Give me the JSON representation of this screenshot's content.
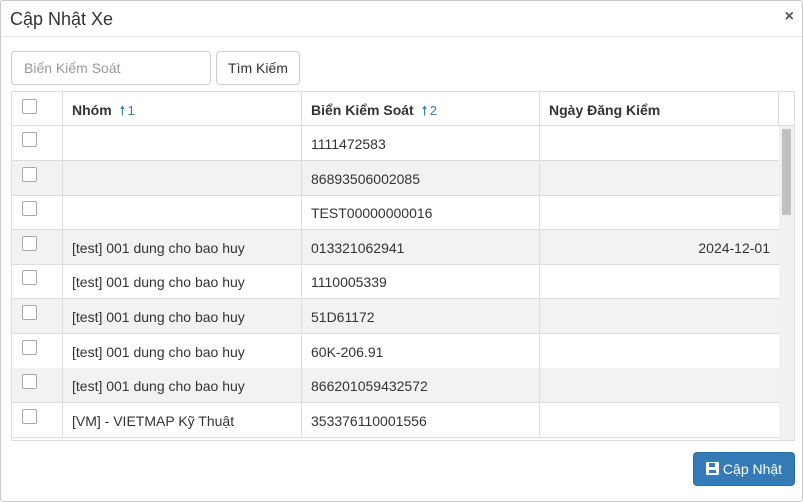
{
  "dialog": {
    "title": "Cập Nhật Xe",
    "close_label": "×"
  },
  "search": {
    "placeholder": "Biển Kiểm Soát",
    "value": "",
    "button_label": "Tìm Kiếm"
  },
  "table": {
    "headers": {
      "group": "Nhóm",
      "group_sort_order": "1",
      "plate": "Biển Kiểm Soát",
      "plate_sort_order": "2",
      "inspection_date": "Ngày Đăng Kiểm"
    },
    "sort_arrow": "🠕",
    "rows": [
      {
        "group": "",
        "plate": "1111472583",
        "date": ""
      },
      {
        "group": "",
        "plate": "86893506002085",
        "date": ""
      },
      {
        "group": "",
        "plate": "TEST00000000016",
        "date": ""
      },
      {
        "group": "[test] 001 dung cho bao huy",
        "plate": "013321062941",
        "date": "2024-12-01"
      },
      {
        "group": "[test] 001 dung cho bao huy",
        "plate": "1110005339",
        "date": ""
      },
      {
        "group": "[test] 001 dung cho bao huy",
        "plate": "51D61172",
        "date": ""
      },
      {
        "group": "[test] 001 dung cho bao huy",
        "plate": "60K-206.91",
        "date": ""
      },
      {
        "group": "[test] 001 dung cho bao huy",
        "plate": "866201059432572",
        "date": ""
      },
      {
        "group": "[VM] - VIETMAP Kỹ Thuật",
        "plate": "353376110001556",
        "date": ""
      }
    ]
  },
  "footer": {
    "update_label": "Cập Nhật",
    "update_icon": "floppy-disk-icon"
  },
  "colors": {
    "primary": "#337ab7",
    "row_alt": "#f2f2f2",
    "border": "#dddddd"
  }
}
